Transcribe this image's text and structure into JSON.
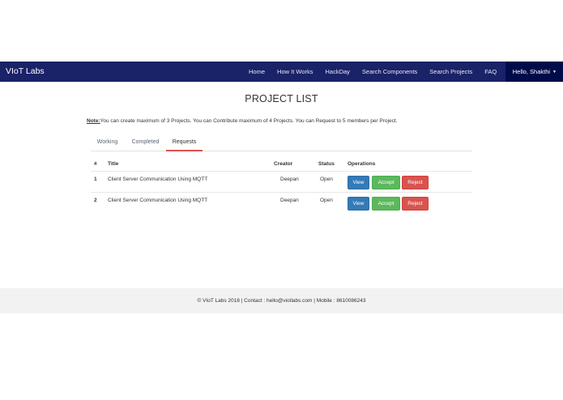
{
  "navbar": {
    "brand": "VIoT Labs",
    "links": [
      "Home",
      "How It Works",
      "HackDay",
      "Search Components",
      "Search Projects",
      "FAQ"
    ],
    "user_label": "Hello, Shakthi",
    "user_caret": "▼"
  },
  "page": {
    "title": "PROJECT LIST",
    "note_label": "Note:",
    "note_text": "You can create maximum of 3 Projects. You can Contribute maximum of 4 Projects. You can Request to 5 members per Project."
  },
  "tabs": [
    "Working",
    "Completed",
    "Requests"
  ],
  "active_tab": "Requests",
  "table": {
    "headers": [
      "#",
      "Title",
      "Creator",
      "Status",
      "Operations"
    ],
    "rows": [
      {
        "num": "1",
        "title": "Client Server Communication Using MQTT",
        "creator": "Deepan",
        "status": "Open"
      },
      {
        "num": "2",
        "title": "Client Server Communication Using MQTT",
        "creator": "Deepan",
        "status": "Open"
      }
    ],
    "buttons": {
      "view": "View",
      "accept": "Accept",
      "reject": "Reject"
    }
  },
  "footer": {
    "text": "© VIoT Labs 2018 | Contact : hello@viotlabs.com | Mobile : 8610086243"
  },
  "colors": {
    "navbar": "#1a2268",
    "navbar_user": "#000b4a",
    "view": "#337ab7",
    "accept": "#5cb85c",
    "reject": "#d9534f",
    "active_tab_underline": "#d9534f"
  }
}
